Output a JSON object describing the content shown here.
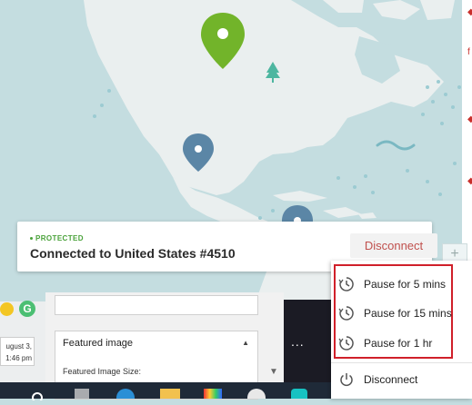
{
  "status": {
    "label": "PROTECTED",
    "connection": "Connected to United States #4510",
    "disconnect_label": "Disconnect"
  },
  "map": {
    "plus_label": "+"
  },
  "pause_menu": {
    "items": [
      {
        "label": "Pause for 5 mins",
        "icon": "clock-pause-icon"
      },
      {
        "label": "Pause for 15 mins",
        "icon": "clock-pause-icon"
      },
      {
        "label": "Pause for 1 hr",
        "icon": "clock-pause-icon"
      }
    ],
    "disconnect": {
      "label": "Disconnect",
      "icon": "power-icon"
    }
  },
  "background": {
    "featured_image_title": "Featured image",
    "featured_image_size_label": "Featured Image Size:",
    "date_line1": "ugust 3,",
    "date_line2": "1:46 pm",
    "ellipsis": "..."
  },
  "colors": {
    "protected_green": "#4aa23a",
    "disconnect_red": "#c0504d",
    "highlight_red": "#d0202a",
    "pin_green": "#72b42a",
    "pin_blue": "#5b86a6"
  }
}
